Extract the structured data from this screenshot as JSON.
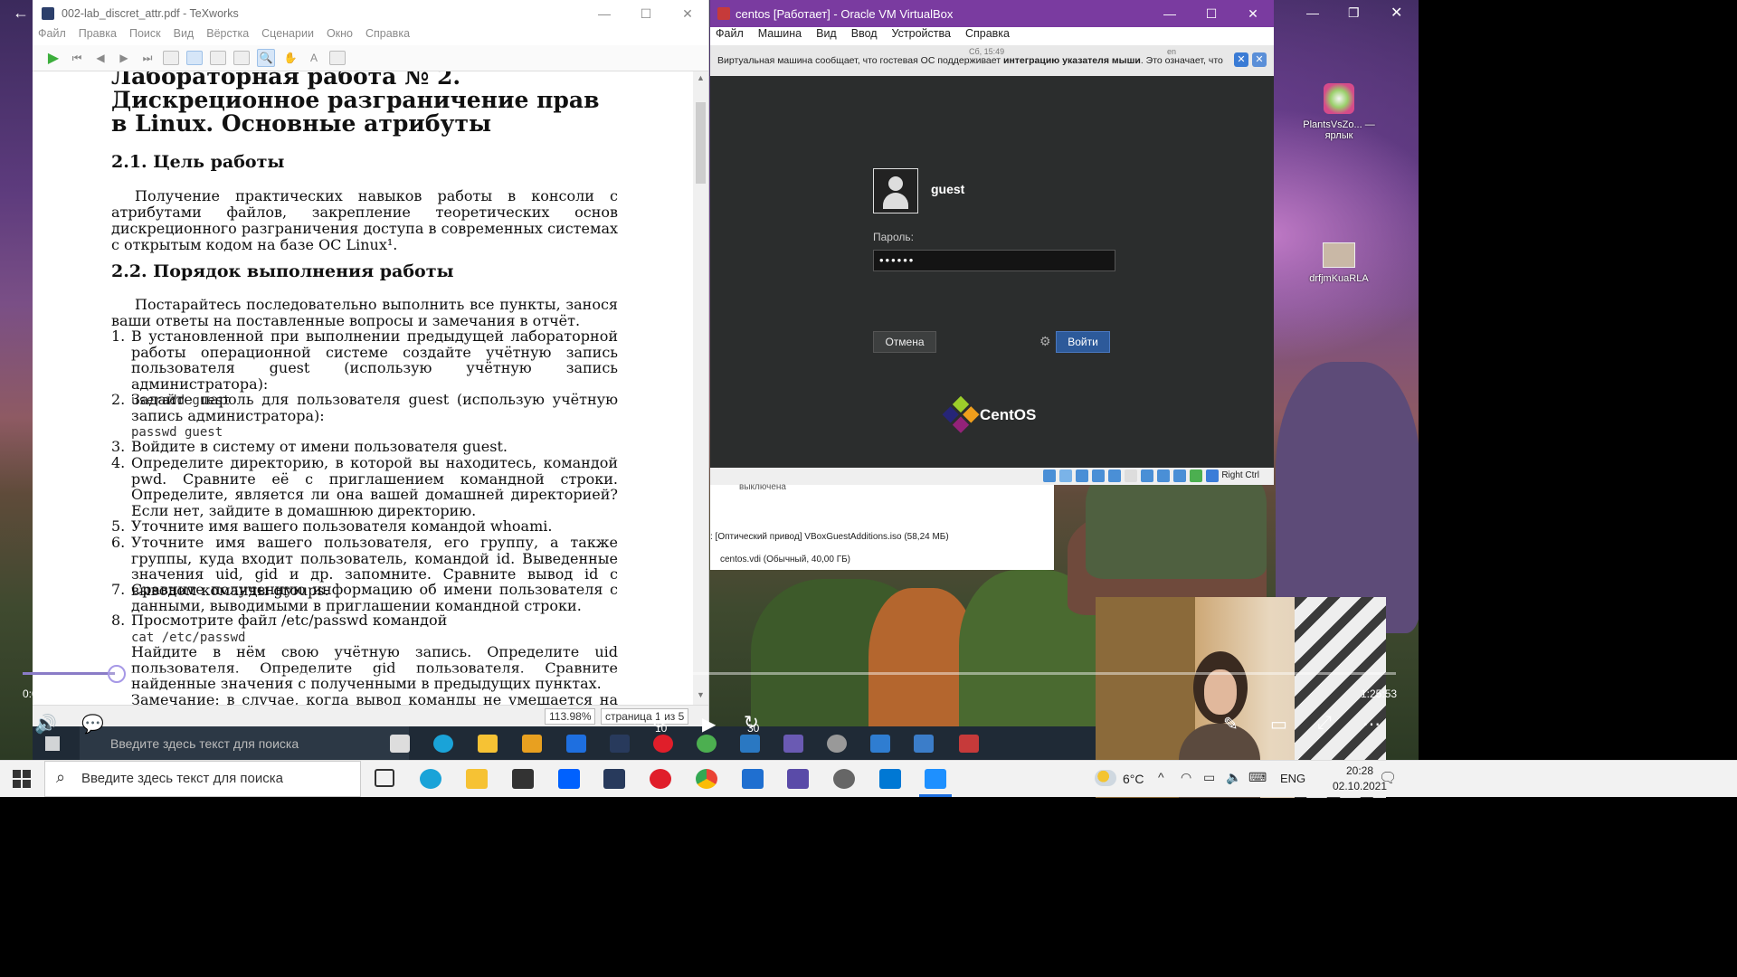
{
  "texworks": {
    "title": "002-lab_discret_attr.pdf - TeXworks",
    "menu": [
      "Файл",
      "Правка",
      "Поиск",
      "Вид",
      "Вёрстка",
      "Сценарии",
      "Окно",
      "Справка"
    ],
    "zoom": "113.98%",
    "page": "страница 1 из 5",
    "doc": {
      "h1": "Лабораторная работа № 2. Дискреционное разграничение прав в Linux. Основные атрибуты",
      "h2_1": "2.1. Цель работы",
      "p1": "Получение практических навыков работы в консоли с атрибутами файлов, закрепление теоретических основ дискреционного разграничения доступа в современных системах с открытым кодом на базе ОС Linux¹.",
      "h2_2": "2.2. Порядок выполнения работы",
      "p2": "Постарайтесь последовательно выполнить все пункты, занося ваши ответы на поставленные вопросы и замечания в отчёт.",
      "items": [
        {
          "n": "1.",
          "text": "В установленной при выполнении предыдущей лабораторной работы операционной системе создайте учётную запись пользователя guest (использую учётную запись администратора):",
          "code": "useradd guest"
        },
        {
          "n": "2.",
          "text": "Задайте пароль для пользователя guest (использую учётную запись администратора):",
          "code": "passwd guest"
        },
        {
          "n": "3.",
          "text": "Войдите в систему от имени пользователя guest.",
          "code": ""
        },
        {
          "n": "4.",
          "text": "Определите директорию, в которой вы находитесь, командой pwd. Сравните её с приглашением командной строки. Определите, является ли она вашей домашней директорией? Если нет, зайдите в домашнюю директорию.",
          "code": ""
        },
        {
          "n": "5.",
          "text": "Уточните имя вашего пользователя командой whoami.",
          "code": ""
        },
        {
          "n": "6.",
          "text": "Уточните имя вашего пользователя, его группу, а также группы, куда входит пользователь, командой id. Выведенные значения uid, gid и др. запомните. Сравните вывод id с выводом команды groups.",
          "code": ""
        },
        {
          "n": "7.",
          "text": "Сравните полученную информацию об имени пользователя с данными, выводимыми в приглашении командной строки.",
          "code": ""
        },
        {
          "n": "8.",
          "text": "Просмотрите файл /etc/passwd командой",
          "code": "cat /etc/passwd"
        }
      ],
      "p3": "Найдите в нём свою учётную запись. Определите uid пользователя. Определите gid пользователя. Сравните найденные значения с полученными в предыдущих пунктах.",
      "p4": "Замечание: в случае, когда вывод команды не умещается на одном"
    }
  },
  "vbox": {
    "title": "centos [Работает] - Oracle VM VirtualBox",
    "menu": [
      "Файл",
      "Машина",
      "Вид",
      "Ввод",
      "Устройства",
      "Справка"
    ],
    "clock": "Сб, 15:49",
    "lang": "en",
    "notice_plain": "Виртуальная машина сообщает, что гостевая ОС поддерживает ",
    "notice_bold": "интеграцию указателя мыши",
    "notice_tail": ". Это означает, что не",
    "login": {
      "user": "guest",
      "password_label": "Пароль:",
      "password_value": "••••••",
      "cancel": "Отмена",
      "signin": "Войти",
      "brand": "CentOS"
    },
    "host_key": "Right Ctrl",
    "manager": {
      "row1": "выключена",
      "row2": ":   [Оптический привод] VBoxGuestAdditions.iso (58,24 МБ)",
      "row3": "centos.vdi (Обычный, 40,00 ГБ)"
    }
  },
  "desktop": {
    "icon1": "PlantsVsZo... — ярлык",
    "icon2": "drfjmKuaRLA"
  },
  "player": {
    "current": "0:00:00",
    "duration": "1:25:53",
    "rewind": "10",
    "forward": "30",
    "progress": 0.0
  },
  "inner_taskbar": {
    "search": "Введите здесь текст для поиска"
  },
  "taskbar": {
    "search": "Введите здесь текст для поиска",
    "temp": "6°C",
    "lang": "ENG",
    "time": "20:28",
    "date": "02.10.2021"
  }
}
